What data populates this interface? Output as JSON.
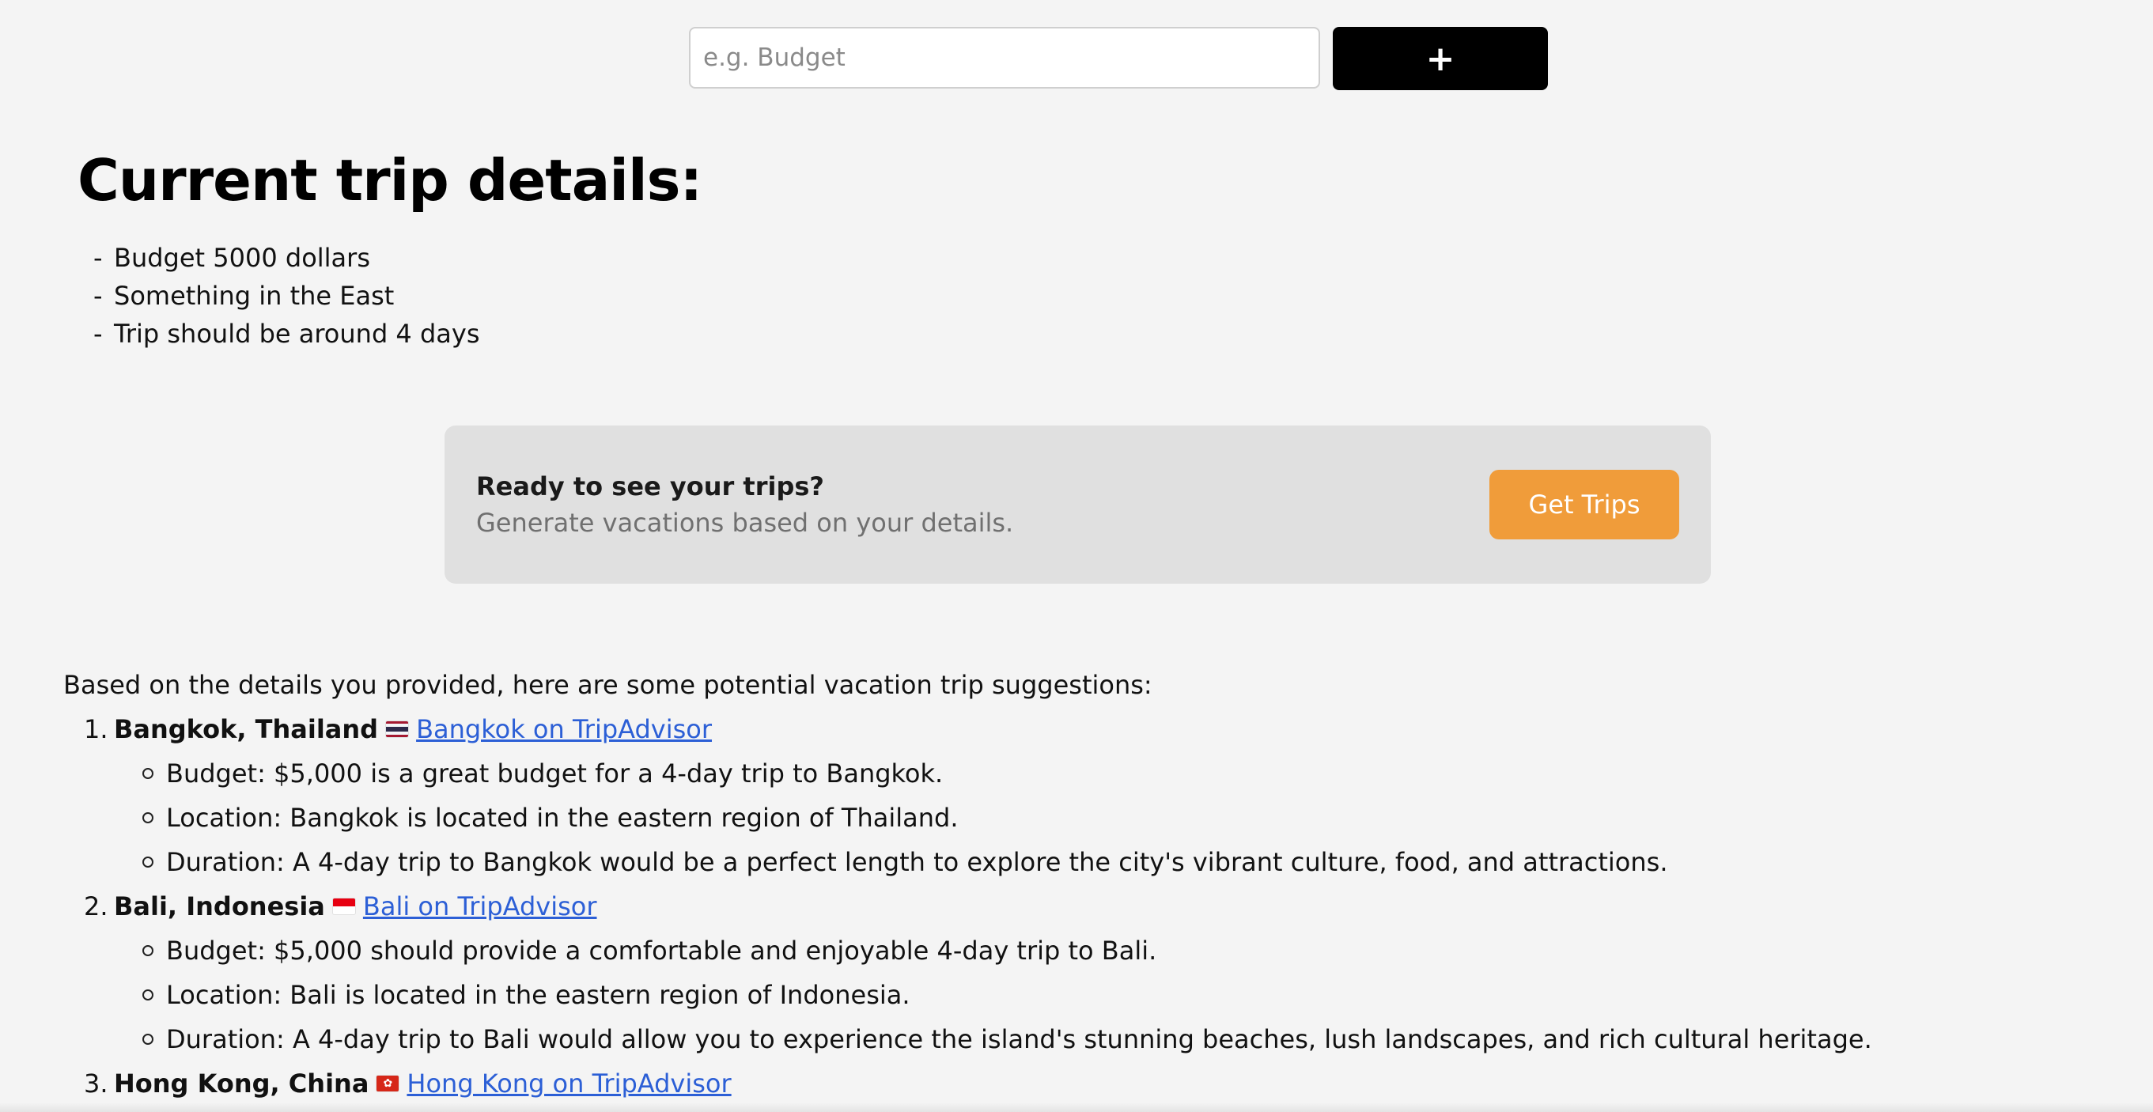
{
  "input_row": {
    "placeholder": "e.g. Budget",
    "value": "",
    "add_label": "+"
  },
  "page_title": "Current trip details:",
  "details": [
    {
      "marker": "-",
      "text": "Budget 5000 dollars"
    },
    {
      "marker": "-",
      "text": "Something in the East"
    },
    {
      "marker": "-",
      "text": "Trip should be around 4 days"
    }
  ],
  "cta": {
    "heading": "Ready to see your trips?",
    "subheading": "Generate vacations based on your details.",
    "button_label": "Get Trips"
  },
  "results": {
    "intro": "Based on the details you provided, here are some potential vacation trip suggestions:",
    "trips": [
      {
        "number": "1.",
        "name": "Bangkok, Thailand",
        "flag": "thailand-flag-icon",
        "link_text": "Bangkok on TripAdvisor",
        "points": [
          "Budget: $5,000 is a great budget for a 4-day trip to Bangkok.",
          "Location: Bangkok is located in the eastern region of Thailand.",
          "Duration: A 4-day trip to Bangkok would be a perfect length to explore the city's vibrant culture, food, and attractions."
        ]
      },
      {
        "number": "2.",
        "name": "Bali, Indonesia",
        "flag": "indonesia-flag-icon",
        "link_text": "Bali on TripAdvisor",
        "points": [
          "Budget: $5,000 should provide a comfortable and enjoyable 4-day trip to Bali.",
          "Location: Bali is located in the eastern region of Indonesia.",
          "Duration: A 4-day trip to Bali would allow you to experience the island's stunning beaches, lush landscapes, and rich cultural heritage."
        ]
      },
      {
        "number": "3.",
        "name": "Hong Kong, China",
        "flag": "hong-kong-flag-icon",
        "link_text": "Hong Kong on TripAdvisor",
        "points": []
      }
    ]
  },
  "colors": {
    "background": "#f4f4f4",
    "card": "#e0e0e0",
    "accent": "#f09c3a",
    "link": "#2c5fd6"
  }
}
